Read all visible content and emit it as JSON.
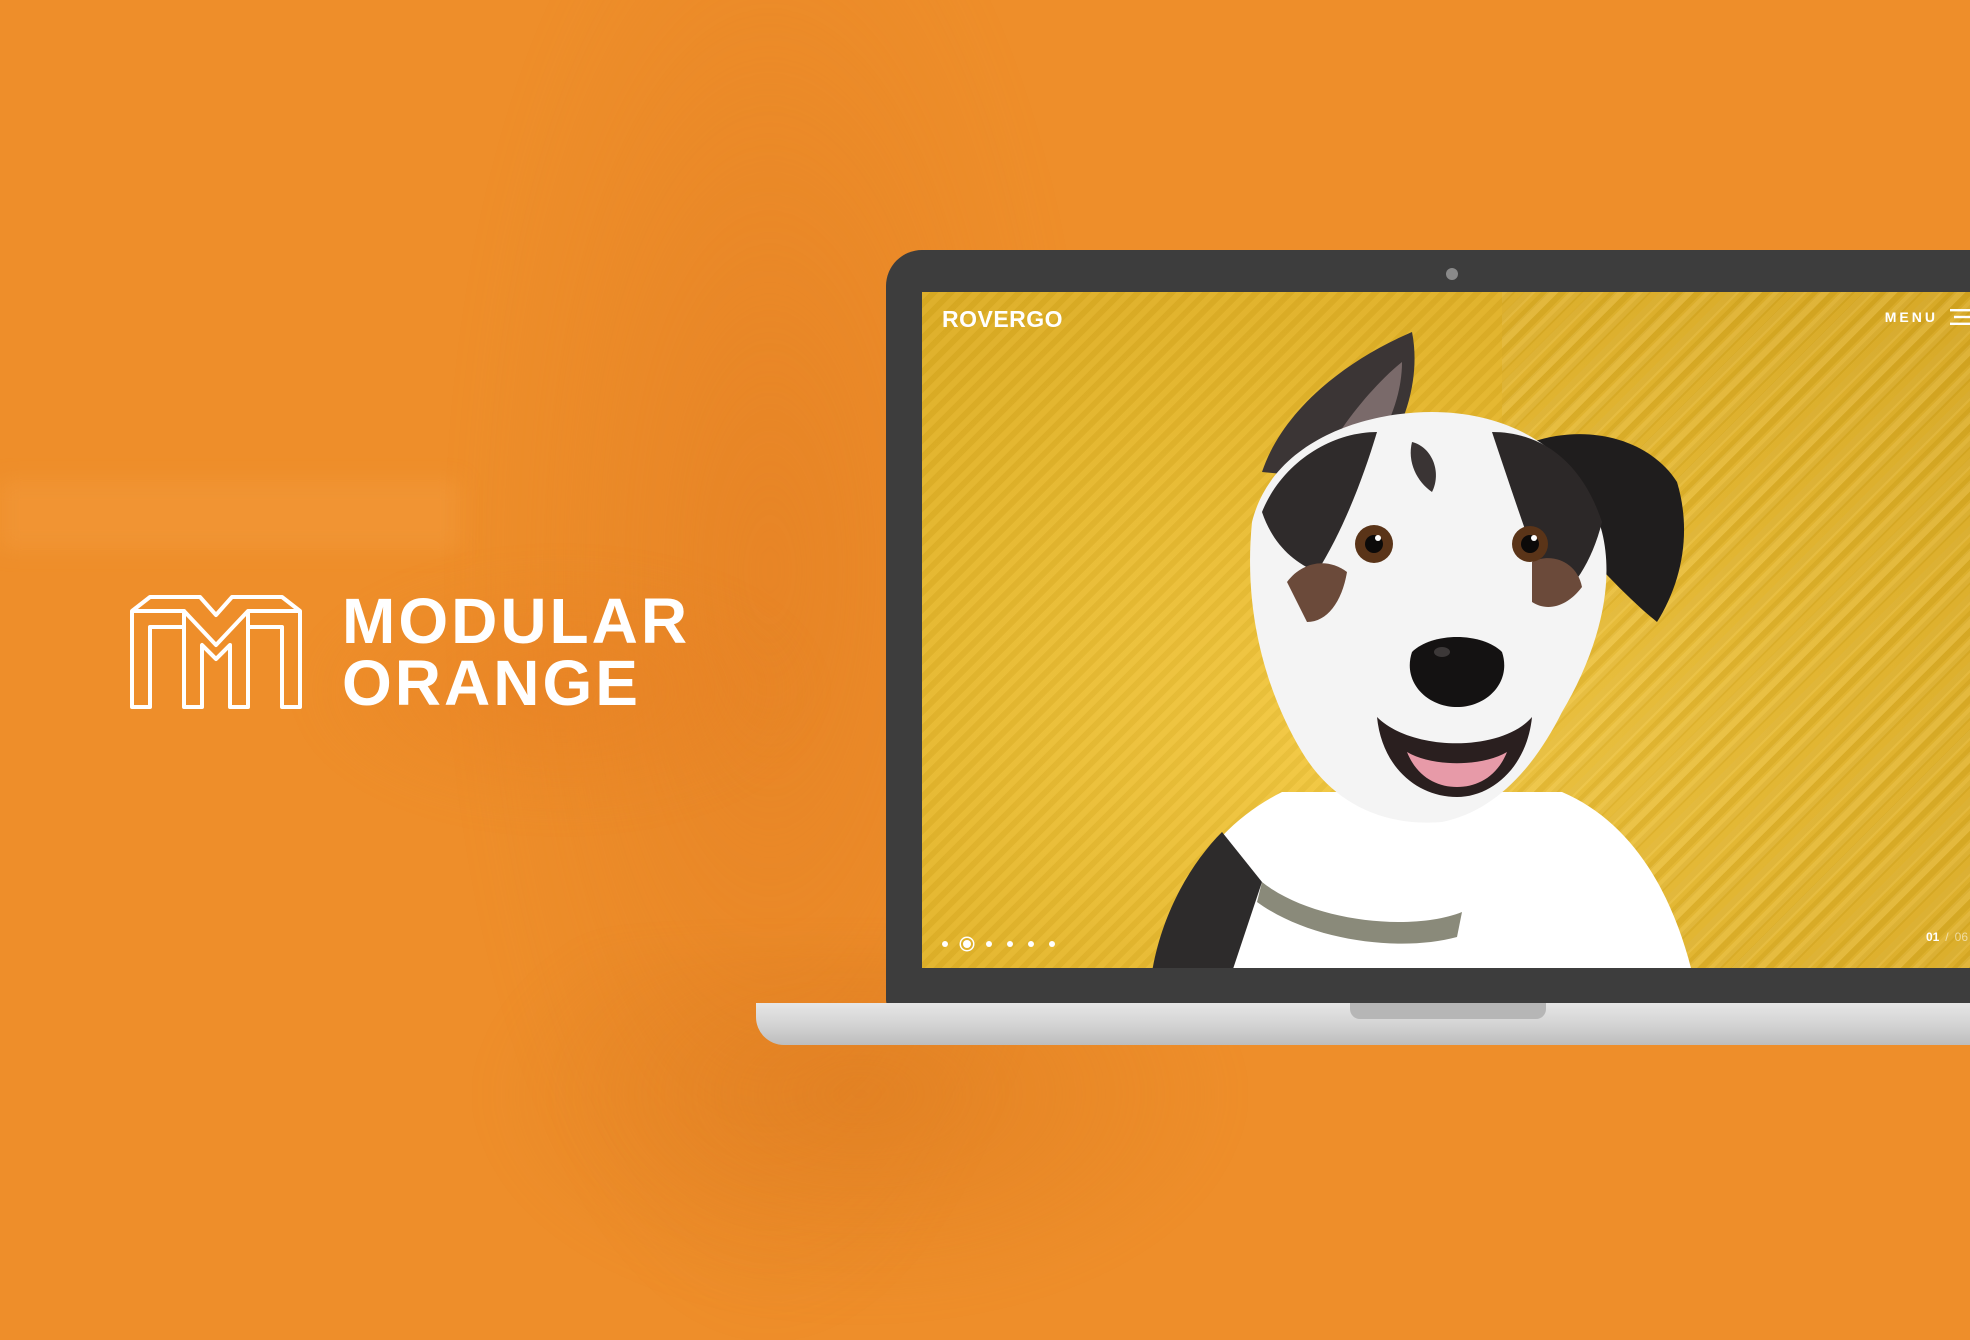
{
  "brand": {
    "logo_icon": "modular-m-logo-icon",
    "line1": "MODULAR",
    "line2": "ORANGE"
  },
  "site": {
    "logo": "ROVERGO",
    "menu_label": "MENU",
    "menu_icon": "hamburger-icon",
    "slider": {
      "current": "01",
      "separator": "/",
      "total": "06",
      "slide_count": 6,
      "active_index": 1
    },
    "hero_image": "dog-portrait"
  },
  "colors": {
    "background": "#ee8e2a",
    "screen_background": "#e8b82c",
    "laptop_bezel": "#3d3d3d",
    "laptop_base": "#d2d2d2"
  }
}
